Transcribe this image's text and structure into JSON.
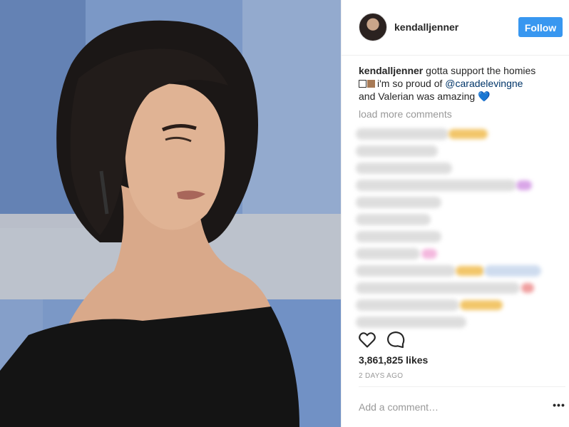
{
  "post": {
    "username": "kendalljenner",
    "follow_label": "Follow",
    "caption": {
      "user": "kendalljenner",
      "text_1": " gotta support the homies",
      "text_2": "i'm so proud of ",
      "mention": "@caradelevingne",
      "text_3": "and Valerian was amazing ",
      "heart": "💙"
    },
    "load_more": "load more comments",
    "likes": "3,861,825 likes",
    "time": "2 DAYS AGO",
    "comment_placeholder": "Add a comment…",
    "more_label": "•••"
  },
  "colors": {
    "follow_bg": "#3897f0",
    "mention": "#003569",
    "muted": "#999999"
  },
  "icons": [
    "heart-icon",
    "comment-icon",
    "more-options-icon"
  ]
}
